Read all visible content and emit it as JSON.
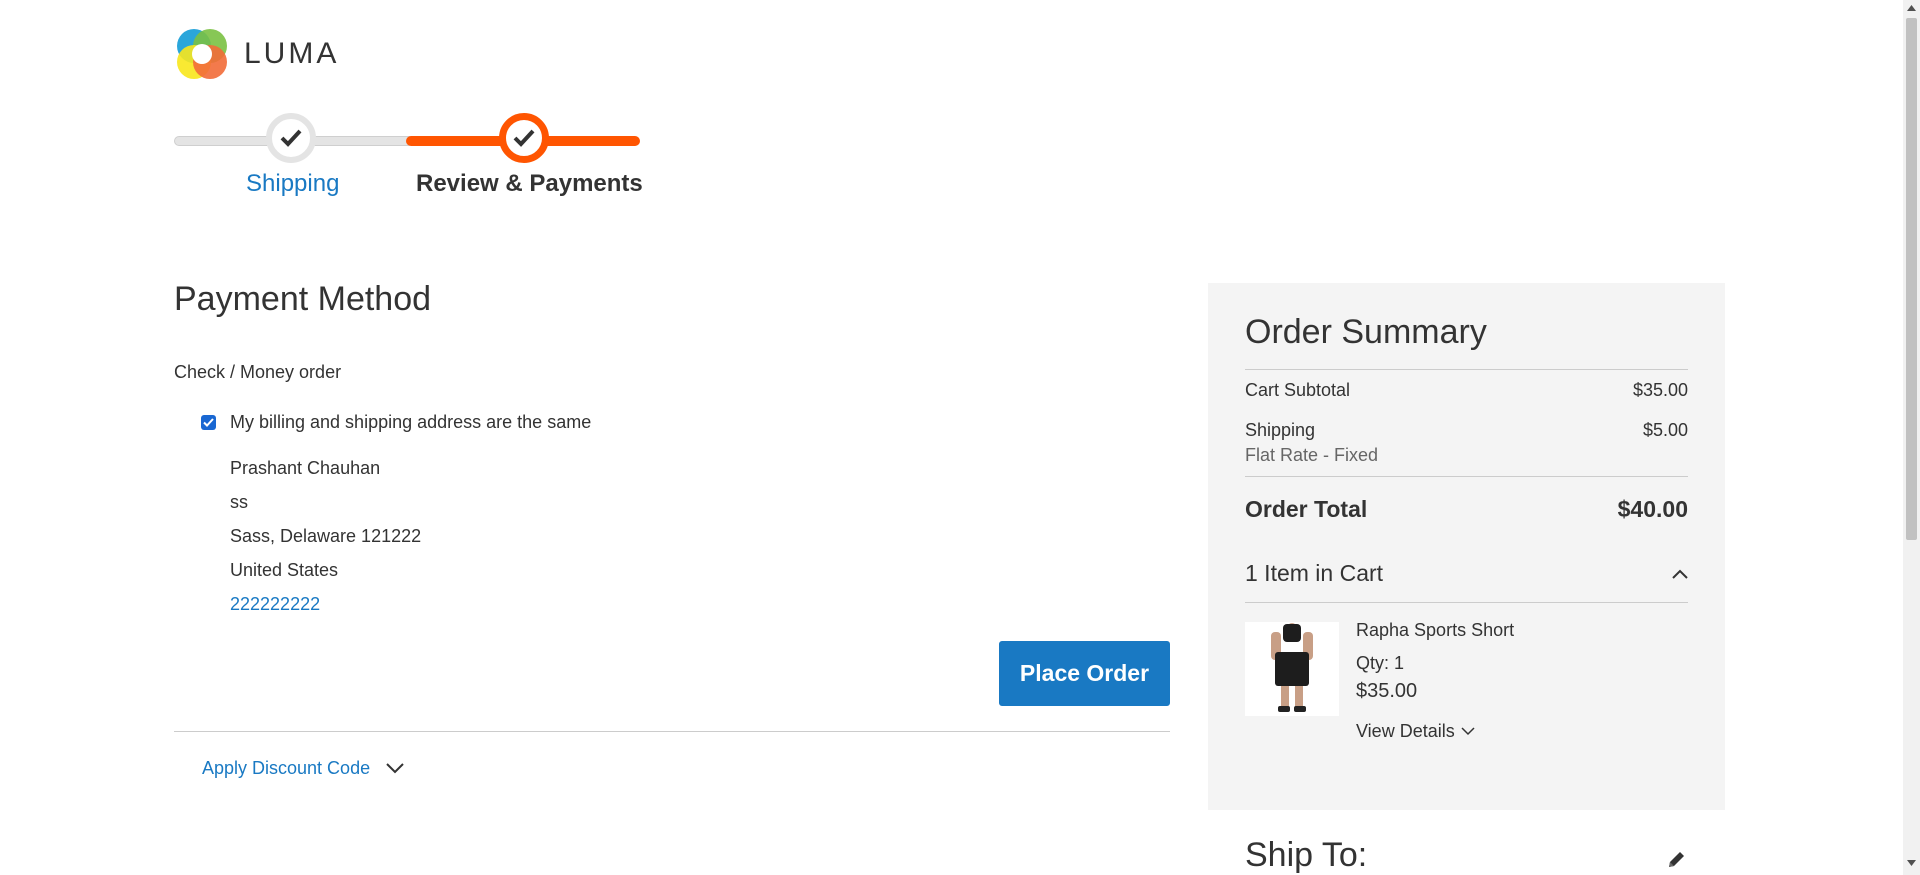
{
  "brand": {
    "name": "LUMA"
  },
  "progress": {
    "steps": [
      {
        "label": "Shipping",
        "state": "complete"
      },
      {
        "label": "Review & Payments",
        "state": "current"
      }
    ],
    "accent_color": "#ff5501"
  },
  "payment": {
    "title": "Payment Method",
    "method": "Check / Money order",
    "same_address_label": "My billing and shipping address are the same",
    "same_address_checked": true,
    "address": {
      "name": "Prashant Chauhan",
      "street": "ss",
      "city_line": "Sass, Delaware 121222",
      "country": "United States",
      "phone": "222222222"
    },
    "place_order_label": "Place Order",
    "discount_label": "Apply Discount Code"
  },
  "summary": {
    "title": "Order Summary",
    "subtotal_label": "Cart Subtotal",
    "subtotal_value": "$35.00",
    "shipping_label": "Shipping",
    "shipping_method": "Flat Rate - Fixed",
    "shipping_value": "$5.00",
    "total_label": "Order Total",
    "total_value": "$40.00",
    "items_label": "1 Item in Cart",
    "item": {
      "name": "Rapha Sports Short",
      "qty": "Qty: 1",
      "price": "$35.00",
      "details_label": "View Details"
    }
  },
  "ship_to": {
    "title": "Ship To:"
  },
  "colors": {
    "link": "#1979c3",
    "button": "#1979c3",
    "summary_bg": "#f4f4f4"
  }
}
